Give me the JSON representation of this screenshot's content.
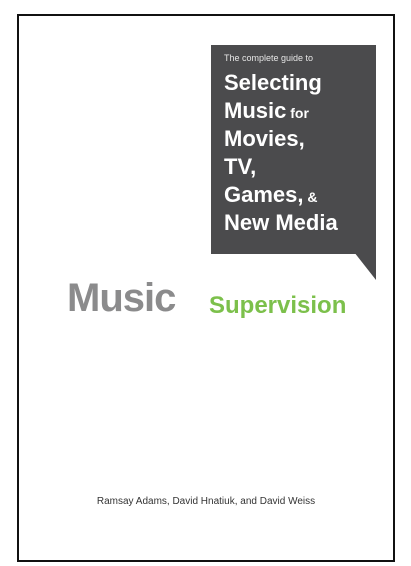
{
  "cover": {
    "bubble": {
      "intro": "The complete guide to",
      "lines": [
        {
          "main": "Selecting",
          "small": ""
        },
        {
          "main": "Music",
          "small": " for"
        },
        {
          "main": "Movies,",
          "small": ""
        },
        {
          "main": "TV,",
          "small": ""
        },
        {
          "main": "Games,",
          "small": " &"
        },
        {
          "main": "New Media",
          "small": ""
        }
      ]
    },
    "title_main": "Music",
    "title_sub": "Supervision",
    "authors": "Ramsay Adams, David Hnatiuk, and David Weiss"
  },
  "colors": {
    "bubble_bg": "#4b4b4d",
    "title_main": "#8b8b8c",
    "title_sub": "#7cc04b",
    "border": "#111111"
  }
}
